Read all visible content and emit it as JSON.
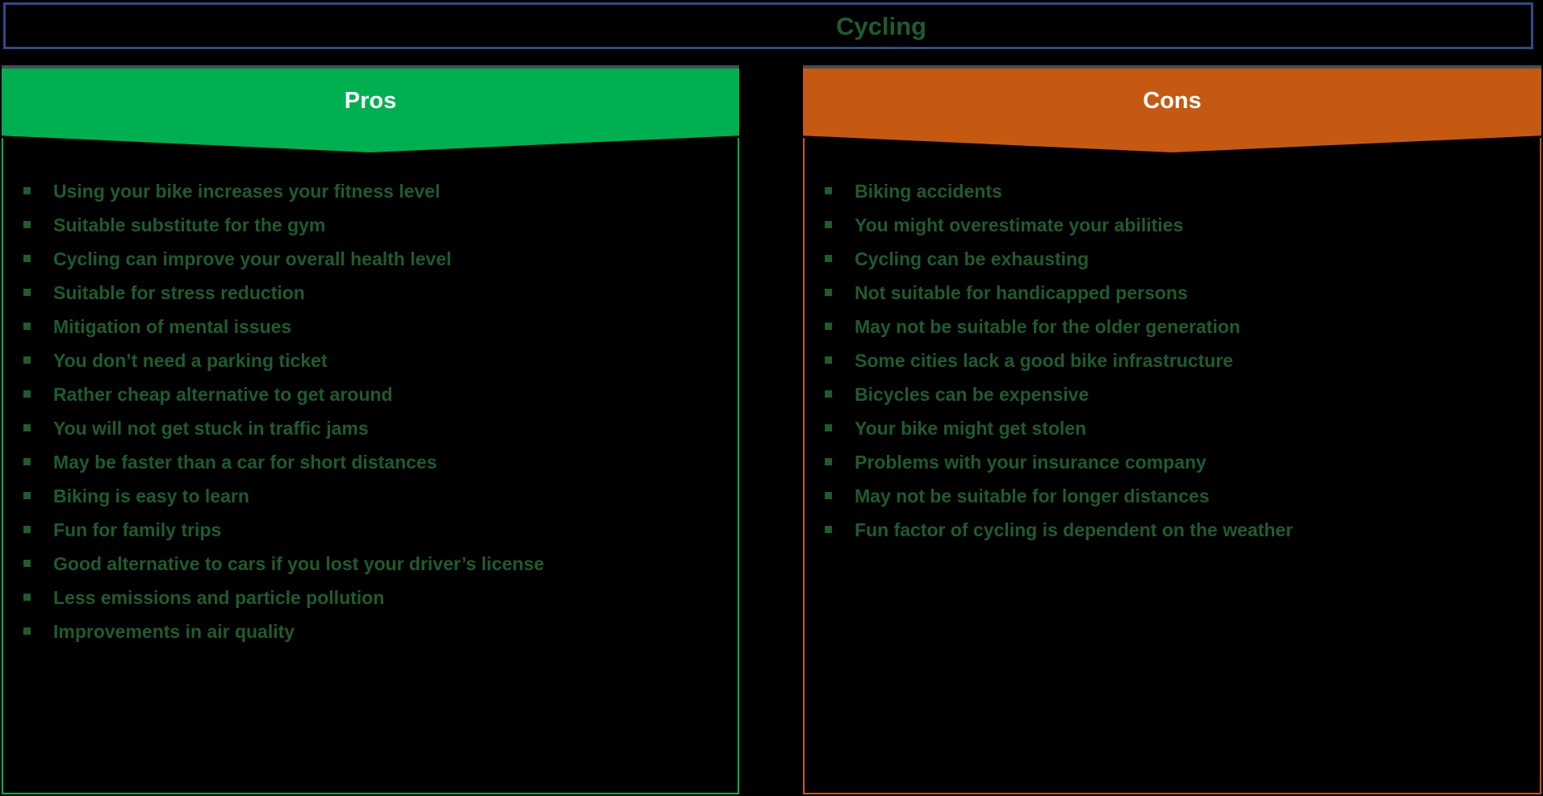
{
  "title": {
    "text": "Cycling",
    "border_color": "#2e4b8c",
    "text_color": "#1f5b2e"
  },
  "colors": {
    "background": "#000000",
    "pros_accent": "#00b050",
    "cons_accent": "#c65911",
    "body_text": "#1f5b2e",
    "header_text": "#ffffff"
  },
  "pros": {
    "header_label": "Pros",
    "items": [
      "Using your bike increases your fitness level",
      "Suitable substitute for the gym",
      "Cycling can improve your overall health level",
      "Suitable for stress reduction",
      "Mitigation of mental issues",
      "You don’t need a parking ticket",
      "Rather cheap alternative to get around",
      "You will not get stuck in traffic jams",
      "May be faster than a car for short distances",
      "Biking is easy to learn",
      "Fun for family trips",
      "Good alternative to cars if you lost your driver’s license",
      "Less emissions and particle pollution",
      "Improvements in air quality"
    ]
  },
  "cons": {
    "header_label": "Cons",
    "items": [
      "Biking accidents",
      "You might overestimate your abilities",
      "Cycling can be exhausting",
      "Not suitable for handicapped persons",
      "May not be suitable for the older generation",
      "Some cities lack a good bike infrastructure",
      "Bicycles can be expensive",
      "Your bike might get stolen",
      "Problems with your insurance company",
      "May not be suitable for longer distances",
      "Fun factor of cycling is dependent on the weather"
    ]
  }
}
